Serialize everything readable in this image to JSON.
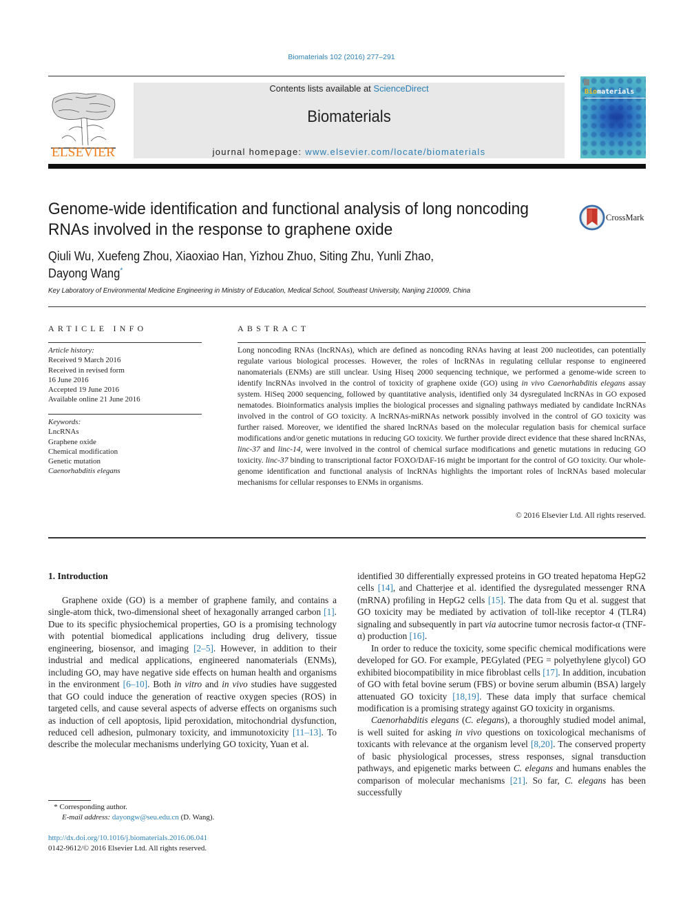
{
  "header": {
    "journal_ref": "Biomaterials 102 (2016) 277–291",
    "contents_prefix": "Contents lists available at ",
    "contents_link": "ScienceDirect",
    "journal_name": "Biomaterials",
    "homepage_prefix": "journal homepage: ",
    "homepage_link": "www.elsevier.com/locate/biomaterials",
    "publisher_logo_text": "ELSEVIER",
    "cover_title_highlight": "Bio",
    "cover_title_rest": "materials",
    "colors": {
      "link": "#2a7fb4",
      "elsevier_orange": "#f07d1a"
    }
  },
  "article": {
    "title": "Genome-wide identification and functional analysis of long noncoding RNAs involved in the response to graphene oxide",
    "crossmark_label": "CrossMark",
    "authors": "Qiuli Wu, Xuefeng Zhou, Xiaoxiao Han, Yizhou Zhuo, Siting Zhu, Yunli Zhao,",
    "authors_line2": "Dayong Wang",
    "corresponding_mark": "*",
    "affiliation": "Key Laboratory of Environmental Medicine Engineering in Ministry of Education, Medical School, Southeast University, Nanjing 210009, China"
  },
  "article_info": {
    "heading": "ARTICLE INFO",
    "history_label": "Article history:",
    "history": [
      "Received 9 March 2016",
      "Received in revised form",
      "16 June 2016",
      "Accepted 19 June 2016",
      "Available online 21 June 2016"
    ],
    "keywords_label": "Keywords:",
    "keywords": [
      "LncRNAs",
      "Graphene oxide",
      "Chemical modification",
      "Genetic mutation",
      "Caenorhabditis elegans"
    ]
  },
  "abstract": {
    "heading": "ABSTRACT",
    "p1": "Long noncoding RNAs (lncRNAs), which are defined as noncoding RNAs having at least 200 nucleotides, can potentially regulate various biological processes. However, the roles of lncRNAs in regulating cellular response to engineered nanomaterials (ENMs) are still unclear. Using Hiseq 2000 sequencing technique, we performed a genome-wide screen to identify lncRNAs involved in the control of toxicity of graphene oxide (GO) using ",
    "p1_it": "in vivo Caenorhabditis elegans",
    "p2": " assay system. HiSeq 2000 sequencing, followed by quantitative analysis, identified only 34 dysregulated lncRNAs in GO exposed nematodes. Bioinformatics analysis implies the biological processes and signaling pathways mediated by candidate lncRNAs involved in the control of GO toxicity. A lncRNAs-miRNAs network possibly involved in the control of GO toxicity was further raised. Moreover, we identified the shared lncRNAs based on the molecular regulation basis for chemical surface modifications and/or genetic mutations in reducing GO toxicity. We further provide direct evidence that these shared lncRNAs, ",
    "linc37": "linc-37",
    "and": " and ",
    "linc14": "linc-14",
    "p3": ", were involved in the control of chemical surface modifications and genetic mutations in reducing GO toxicity. ",
    "p4": " binding to transcriptional factor FOXO/DAF-16 might be important for the control of GO toxicity. Our whole-genome identification and functional analysis of lncRNAs highlights the important roles of lncRNAs based molecular mechanisms for cellular responses to ENMs in organisms.",
    "copyright": "© 2016 Elsevier Ltd. All rights reserved."
  },
  "intro": {
    "heading": "1.  Introduction",
    "left": {
      "a": "Graphene oxide (GO) is a member of graphene family, and contains a single-atom thick, two-dimensional sheet of hexagonally arranged carbon ",
      "r1": "[1]",
      "b": ". Due to its specific physiochemical properties, GO is a promising technology with potential biomedical applications including drug delivery, tissue engineering, biosensor, and imaging ",
      "r2": "[2–5]",
      "c": ". However, in addition to their industrial and medical applications, engineered nanomaterials (ENMs), including GO, may have negative side effects on human health and organisms in the environment ",
      "r3": "[6–10]",
      "d": ". Both ",
      "it1": "in vitro",
      "e": " and ",
      "it2": "in vivo",
      "f": " studies have suggested that GO could induce the generation of reactive oxygen species (ROS) in targeted cells, and cause several aspects of adverse effects on organisms such as induction of cell apoptosis, lipid peroxidation, mitochondrial dysfunction, reduced cell adhesion, pulmonary toxicity, and immunotoxicity ",
      "r4": "[11–13]",
      "g": ". To describe the molecular mechanisms underlying GO toxicity, Yuan et al."
    },
    "right": {
      "p1a": "identified 30 differentially expressed proteins in GO treated hepatoma HepG2 cells ",
      "r14": "[14]",
      "p1b": ", and Chatterjee et al. identified the dysregulated messenger RNA (mRNA) profiling in HepG2 cells ",
      "r15": "[15]",
      "p1c": ". The data from Qu et al. suggest that GO toxicity may be mediated by activation of toll-like receptor 4 (TLR4) signaling and subsequently in part ",
      "via": "via",
      "p1d": " autocrine tumor necrosis factor-α (TNF-α) production ",
      "r16": "[16]",
      "p1e": ".",
      "p2a": "In order to reduce the toxicity, some specific chemical modifications were developed for GO. For example, PEGylated (PEG = polyethylene glycol) GO exhibited biocompatibility in mice fibroblast cells ",
      "r17": "[17]",
      "p2b": ". In addition, incubation of GO with fetal bovine serum (FBS) or bovine serum albumin (BSA) largely attenuated GO toxicity ",
      "r18": "[18,19]",
      "p2c": ". These data imply that surface chemical modification is a promising strategy against GO toxicity in organisms.",
      "p3it1": "Caenorhabditis elegans",
      "p3a": " (",
      "p3it2": "C. elegans",
      "p3b": "), a thoroughly studied model animal, is well suited for asking ",
      "p3it3": "in vivo",
      "p3c": " questions on toxicological mechanisms of toxicants with relevance at the organism level ",
      "r20": "[8,20]",
      "p3d": ". The conserved property of basic physiological processes, stress responses, signal transduction pathways, and epigenetic marks between ",
      "p3it4": "C. elegans",
      "p3e": " and humans enables the comparison of molecular mechanisms ",
      "r21": "[21]",
      "p3f": ". So far, ",
      "p3it5": "C. elegans",
      "p3g": " has been successfully"
    }
  },
  "footnote": {
    "mark": "*",
    "corresponding": "Corresponding author.",
    "email_label": "E-mail address:",
    "email": "dayongw@seu.edu.cn",
    "email_suffix": " (D. Wang).",
    "doi": "http://dx.doi.org/10.1016/j.biomaterials.2016.06.041",
    "issn": "0142-9612/© 2016 Elsevier Ltd. All rights reserved."
  }
}
